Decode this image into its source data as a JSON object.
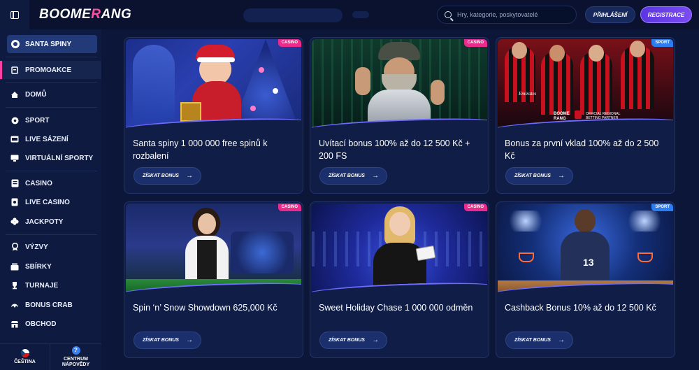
{
  "header": {
    "logo_text": "BOOME",
    "logo_accent": "R",
    "logo_tail": "ANG",
    "search_placeholder": "Hry, kategorie, poskytovatelé",
    "login_label": "PŘIHLÁŠENÍ",
    "register_label": "REGISTRACE"
  },
  "sidebar": {
    "santa_label": "SANTA SPINY",
    "items": [
      {
        "label": "PROMOAKCE",
        "icon": "promo-icon"
      },
      {
        "label": "DOMŮ",
        "icon": "home-icon"
      },
      {
        "label": "SPORT",
        "icon": "soccer-ball-icon"
      },
      {
        "label": "LIVE SÁZENÍ",
        "icon": "live-betting-icon"
      },
      {
        "label": "VIRTUÁLNÍ SPORTY",
        "icon": "virtual-sports-icon"
      },
      {
        "label": "CASINO",
        "icon": "casino-icon"
      },
      {
        "label": "LIVE CASINO",
        "icon": "live-casino-icon"
      },
      {
        "label": "JACKPOTY",
        "icon": "clover-icon"
      },
      {
        "label": "VÝZVY",
        "icon": "challenge-icon"
      },
      {
        "label": "SBÍRKY",
        "icon": "collection-icon"
      },
      {
        "label": "TURNAJE",
        "icon": "trophy-icon"
      },
      {
        "label": "BONUS CRAB",
        "icon": "crab-icon"
      },
      {
        "label": "OBCHOD",
        "icon": "shop-icon"
      }
    ],
    "language_label": "ČEŠTINA",
    "help_label_1": "CENTRUM",
    "help_label_2": "NÁPOVĚDY"
  },
  "cards": [
    {
      "badge": "CASINO",
      "badge_type": "casino",
      "title": "Santa spiny 1 000 000 free spinů k rozbalení",
      "button": "ZÍSKAT BONUS"
    },
    {
      "badge": "CASINO",
      "badge_type": "casino",
      "title": "Uvítací bonus 100% až do 12 500 Kč + 200 FS",
      "button": "ZÍSKAT BONUS"
    },
    {
      "badge": "SPORT",
      "badge_type": "sport",
      "title": "Bonus za první vklad 100% až do 2 500 Kč",
      "button": "ZÍSKAT BONUS"
    },
    {
      "badge": "CASINO",
      "badge_type": "casino",
      "title": "Spin ‘n’ Snow Showdown 625,000 Kč",
      "button": "ZÍSKAT BONUS"
    },
    {
      "badge": "CASINO",
      "badge_type": "casino",
      "title": "Sweet Holiday Chase 1 000 000 odměn",
      "button": "ZÍSKAT BONUS"
    },
    {
      "badge": "SPORT",
      "badge_type": "sport",
      "title": "Cashback Bonus 10% až do 12 500 Kč",
      "button": "ZÍSKAT BONUS"
    }
  ],
  "image_captions": {
    "card3_sponsor_1": "Emirates",
    "card3_brand_1": "BOOME",
    "card3_brand_2": "RANG",
    "card3_partner_1": "OFFICIAL REGIONAL",
    "card3_partner_2": "BETTING PARTNER",
    "card6_jersey_number": "13"
  },
  "colors": {
    "background": "#0c1638",
    "sidebar": "#0e1a40",
    "accent_pink": "#ea2b8b",
    "accent_blue": "#2c7df0",
    "register_purple": "#6a40ea"
  }
}
